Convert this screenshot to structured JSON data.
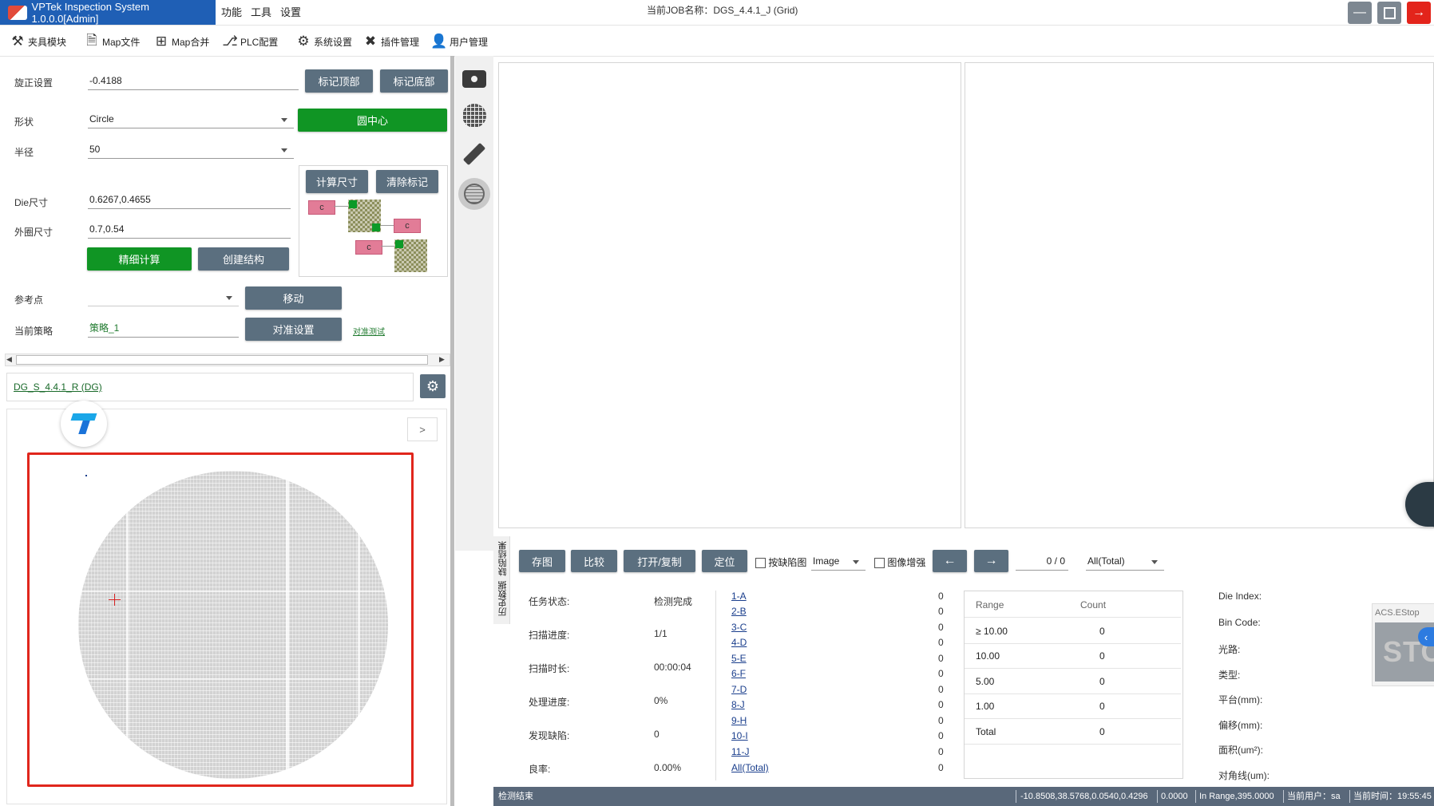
{
  "titlebar": {
    "app_title": "VPTek Inspection System 1.0.0.0[Admin]",
    "menu": [
      "功能",
      "工具",
      "设置"
    ],
    "job_label": "当前JOB名称：",
    "job_name": "DGS_4.4.1_J (Grid)",
    "colors": {
      "brand": "#1f5fb5",
      "close": "#e3241b"
    }
  },
  "toolbar": {
    "items": [
      {
        "label": "夹具模块",
        "icon": "wrench-icon"
      },
      {
        "label": "Map文件",
        "icon": "file-icon"
      },
      {
        "label": "Map合并",
        "icon": "merge-icon"
      },
      {
        "label": "PLC配置",
        "icon": "plc-icon"
      },
      {
        "label": "系统设置",
        "icon": "gear-icon"
      },
      {
        "label": "插件管理",
        "icon": "tools-icon"
      },
      {
        "label": "用户管理",
        "icon": "user-icon"
      }
    ]
  },
  "align": {
    "rotation_label": "旋正设置",
    "rotation_value": "-0.4188",
    "mark_top": "标记顶部",
    "mark_bottom": "标记底部",
    "shape_label": "形状",
    "shape_value": "Circle",
    "circle_center": "圆中心",
    "radius_label": "半径",
    "radius_value": "50",
    "calc_size": "计算尺寸",
    "clear_marks": "清除标记",
    "die_size_label": "Die尺寸",
    "die_size_value": "0.6267,0.4655",
    "outer_size_label": "外圈尺寸",
    "outer_size_value": "0.7,0.54",
    "fine_calc": "精细计算",
    "create_struct": "创建结构",
    "ref_point_label": "参考点",
    "move": "移动",
    "strategy_label": "当前策略",
    "strategy_value": "策略_1",
    "align_settings": "对准设置",
    "align_test": "对准测试",
    "chip_letter": "c"
  },
  "mapfile": {
    "name": "DG_S_4.4.1_R (DG)",
    "expand": ">"
  },
  "side_tools": [
    "camera-icon",
    "grid-icon",
    "ruler-icon",
    "wafer-map-icon"
  ],
  "bottom": {
    "vertical_tabs": [
      "缺陷结果",
      "历史数据"
    ],
    "buttons": [
      "存图",
      "比较",
      "打开/复制",
      "定位"
    ],
    "by_defect_label": "按缺陷图",
    "image_select": "Image",
    "enhance_label": "图像增强",
    "prev": "←",
    "next": "→",
    "page": "0 / 0",
    "filter": "All(Total)",
    "status": [
      {
        "label": "任务状态:",
        "value": "检测完成"
      },
      {
        "label": "扫描进度:",
        "value": "1/1"
      },
      {
        "label": "扫描时长:",
        "value": "00:00:04"
      },
      {
        "label": "处理进度:",
        "value": "0%"
      },
      {
        "label": "发现缺陷:",
        "value": "0"
      },
      {
        "label": "良率:",
        "value": "0.00%"
      }
    ],
    "bins": [
      {
        "name": "1-A",
        "count": "0"
      },
      {
        "name": "2-B",
        "count": "0"
      },
      {
        "name": "3-C",
        "count": "0"
      },
      {
        "name": "4-D",
        "count": "0"
      },
      {
        "name": "5-E",
        "count": "0"
      },
      {
        "name": "6-F",
        "count": "0"
      },
      {
        "name": "7-D",
        "count": "0"
      },
      {
        "name": "8-J",
        "count": "0"
      },
      {
        "name": "9-H",
        "count": "0"
      },
      {
        "name": "10-I",
        "count": "0"
      },
      {
        "name": "11-J",
        "count": "0"
      },
      {
        "name": "All(Total)",
        "count": "0"
      }
    ],
    "range_table": {
      "headers": [
        "Range",
        "Count"
      ],
      "rows": [
        {
          "range": "≥ 10.00",
          "count": "0"
        },
        {
          "range": "10.00",
          "count": "0"
        },
        {
          "range": "5.00",
          "count": "0"
        },
        {
          "range": "1.00",
          "count": "0"
        },
        {
          "range": "Total",
          "count": "0"
        }
      ]
    },
    "die_info": [
      "Die Index:",
      "Bin Code:",
      "光路:",
      "类型:",
      "平台(mm):",
      "偏移(mm):",
      "面积(um²):",
      "对角线(um):"
    ],
    "acs_label": "ACS.EStop",
    "stop_text": "STOP"
  },
  "statusbar": {
    "left": "检测结束",
    "coords": "-10.8508,38.5768,0.0540,0.4296",
    "value": "0.0000",
    "range": "In Range,395.0000",
    "user": "当前用户：sa",
    "time": "当前时间：19:55:45"
  }
}
